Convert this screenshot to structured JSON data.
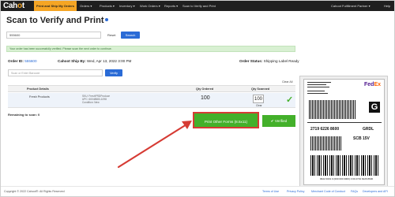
{
  "nav": {
    "logo_prefix": "Cah",
    "logo_o": "o",
    "logo_suffix": "t",
    "items": [
      {
        "label": "Print and Ship My Orders",
        "active": true
      },
      {
        "label": "Orders ▾"
      },
      {
        "label": "Products ▾"
      },
      {
        "label": "Inventory ▾"
      },
      {
        "label": "Work Orders ▾"
      },
      {
        "label": "Reports ▾"
      },
      {
        "label": "Scan to Verify and Print"
      }
    ],
    "account": "Cahoot Fulfillment Partner ▾",
    "help": "Help"
  },
  "page": {
    "title": "Scan to Verify and Print"
  },
  "search": {
    "value": "555600",
    "reset_label": "Reset",
    "search_label": "Search"
  },
  "alert": {
    "text": "Your order has been successfully verified. Please scan the next order to continue."
  },
  "order": {
    "order_label": "Order ID:",
    "order_id": "555600",
    "cutoff_label": "Cahoot Ship By:",
    "cutoff_value": "Wed, Apr 13, 2022 3:00 PM",
    "status_label": "Order Status:",
    "status_value": "Shipping Label Ready"
  },
  "scan": {
    "placeholder": "Scan or Enter Barcode",
    "verify_label": "Verify",
    "clear_all": "Clear All"
  },
  "table": {
    "headers": [
      "Product Details",
      "Qty Ordered",
      "Qty Scanned"
    ],
    "rows": [
      {
        "name": "Fresh Products",
        "sku": "SKU: FreshPRDProduce",
        "upc": "UPC: 60048583-1098",
        "condition": "Condition: New",
        "qty_ordered": "100",
        "qty_scanned": "100",
        "clear": "Clear"
      }
    ]
  },
  "remaining": "Remaining to scan: 0",
  "actions": {
    "print_other_forms": "Print Other Forms (8.5x11)",
    "verified": "✔ Verified"
  },
  "label": {
    "carrier_prefix": "Fed",
    "carrier_suffix": "Ex",
    "tracking": "2719 6226 8600",
    "service_code": "GRDL",
    "routing": "SCB 15V",
    "barcode_text": "9622 0019 0 (000 000 0000) 0 00 2719 6226 8600"
  },
  "footer": {
    "copyright": "Copyright © 2022 Cahoot®. All Rights Reserved",
    "links": [
      "Terms of Use",
      "Privacy Policy",
      "Merchant Code of Conduct",
      "FAQs",
      "Developers and API"
    ]
  },
  "colors": {
    "nav_bg": "#1f1f1f",
    "accent_orange": "#f5a524",
    "primary_blue": "#2a6bd6",
    "success_green": "#43b02a",
    "annotation_red": "#d63b34"
  }
}
